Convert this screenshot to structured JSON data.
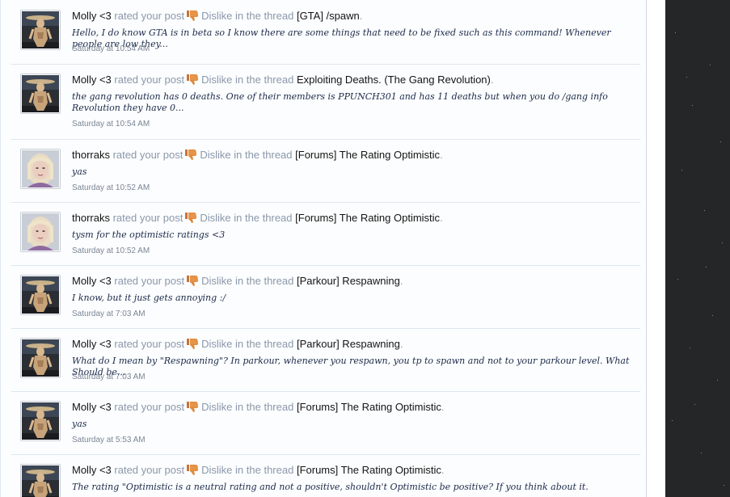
{
  "phrases": {
    "rated": "rated your post",
    "rating": "Dislike",
    "in_thread": "in the thread"
  },
  "colors": {
    "panel_bg": "#fcfdfe",
    "muted_text": "#8a98ab",
    "thumb": "#e08a3c",
    "space_bg": "#252628"
  },
  "alerts": [
    {
      "user": "Molly <3",
      "avatar": "molly",
      "thread": "[GTA] /spawn",
      "excerpt": "Hello, I do know GTA is in beta so I know there are some things that need to be fixed such as this command! Whenever people are low they...",
      "time": "Saturday at 10:54 AM"
    },
    {
      "user": "Molly <3",
      "avatar": "molly",
      "thread": "Exploiting Deaths. (The Gang Revolution)",
      "excerpt": "the gang revolution has 0 deaths. One of their members is PPUNCH301 and has 11 deaths but when you do /gang info Revolution they have 0...",
      "time": "Saturday at 10:54 AM"
    },
    {
      "user": "thorraks",
      "avatar": "thorraks",
      "thread": "[Forums] The Rating Optimistic",
      "excerpt": "yas",
      "time": "Saturday at 10:52 AM"
    },
    {
      "user": "thorraks",
      "avatar": "thorraks",
      "thread": "[Forums] The Rating Optimistic",
      "excerpt": "tysm for the optimistic ratings <3",
      "time": "Saturday at 10:52 AM"
    },
    {
      "user": "Molly <3",
      "avatar": "molly",
      "thread": "[Parkour] Respawning",
      "excerpt": "I know, but it just gets annoying :/",
      "time": "Saturday at 7:03 AM"
    },
    {
      "user": "Molly <3",
      "avatar": "molly",
      "thread": "[Parkour] Respawning",
      "excerpt": "What do I mean by \"Respawning\"? In parkour, whenever you respawn, you tp to spawn and not to your parkour level. What Should be...",
      "time": "Saturday at 7:03 AM"
    },
    {
      "user": "Molly <3",
      "avatar": "molly",
      "thread": "[Forums] The Rating Optimistic",
      "excerpt": "yas",
      "time": "Saturday at 5:53 AM"
    },
    {
      "user": "Molly <3",
      "avatar": "molly",
      "thread": "[Forums] The Rating Optimistic",
      "excerpt": "The rating \"Optimistic is a neutral rating and not a positive, shouldn't Optimistic be positive? If you think about it.",
      "time": ""
    }
  ]
}
